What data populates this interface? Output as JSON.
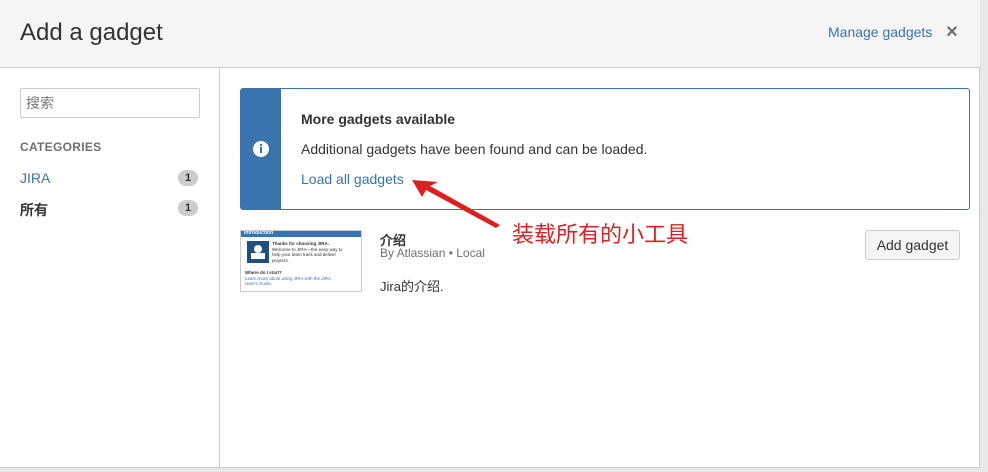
{
  "header": {
    "title": "Add a gadget",
    "manage_label": "Manage gadgets",
    "close_glyph": "×"
  },
  "sidebar": {
    "search_placeholder": "搜索",
    "categories_heading": "CATEGORIES",
    "categories": [
      {
        "label": "JIRA",
        "count": "1"
      },
      {
        "label": "所有",
        "count": "1"
      }
    ]
  },
  "info_message": {
    "icon": "info-icon",
    "title": "More gadgets available",
    "text": "Additional gadgets have been found and can be loaded.",
    "link_label": "Load all gadgets"
  },
  "gadget": {
    "name": "介绍",
    "author": "By Atlassian • Local",
    "description": "Jira的介绍.",
    "add_label": "Add gadget",
    "thumbnail": {
      "bar_title": "Introduction",
      "line1": "Thanks for choosing JIRA.",
      "line2": "Welcome to JIRA—the easy way to",
      "line3": "help your team track and deliver",
      "line4": "projects.",
      "line5": "Where do I start?",
      "line6": "Learn more about using JIRA with the JIRA",
      "line7": "User's Guide."
    }
  },
  "annotation": {
    "text": "装载所有的小工具",
    "color": "#e02020"
  },
  "colors": {
    "accent": "#3b73af",
    "header_bg": "#f5f5f5",
    "border": "#cccccc"
  }
}
